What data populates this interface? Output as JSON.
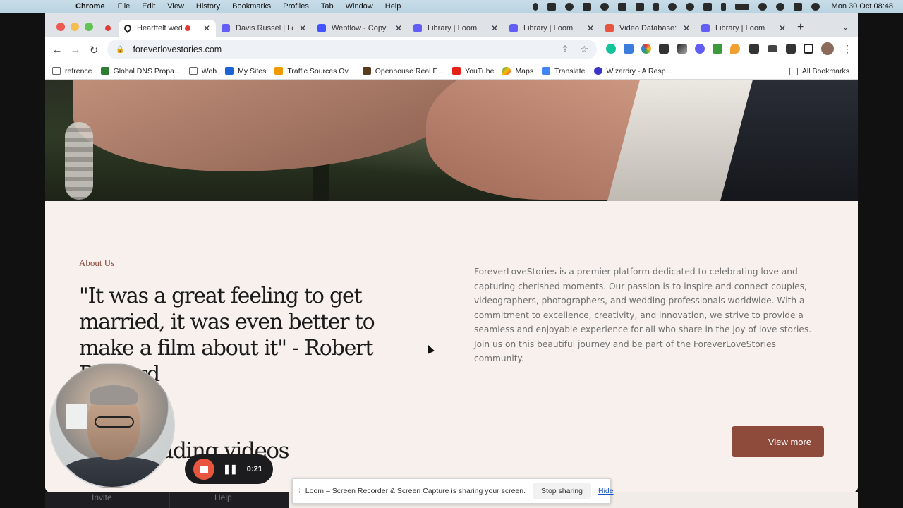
{
  "menubar": {
    "app": "Chrome",
    "items": [
      "File",
      "Edit",
      "View",
      "History",
      "Bookmarks",
      "Profiles",
      "Tab",
      "Window",
      "Help"
    ],
    "clock": "Mon 30 Oct  08:48"
  },
  "tabs": [
    {
      "title": "Heartfelt wed",
      "fav_color": "#222222",
      "active": true
    },
    {
      "title": "Davis Russel | Loo",
      "fav_color": "#625df5",
      "active": false
    },
    {
      "title": "Webflow - Copy o",
      "fav_color": "#4353ff",
      "active": false
    },
    {
      "title": "Library | Loom",
      "fav_color": "#625df5",
      "active": false
    },
    {
      "title": "Library | Loom",
      "fav_color": "#625df5",
      "active": false
    },
    {
      "title": "Video Database: V",
      "fav_color": "#e8553f",
      "active": false
    },
    {
      "title": "Library | Loom",
      "fav_color": "#625df5",
      "active": false
    }
  ],
  "address": {
    "url": "foreverlovestories.com"
  },
  "bookmarks": [
    {
      "label": "refrence",
      "icon": "folder-icon"
    },
    {
      "label": "Global DNS Propa...",
      "icon": "globe-icon"
    },
    {
      "label": "Web",
      "icon": "folder-icon"
    },
    {
      "label": "My Sites",
      "icon": "wordpress-icon"
    },
    {
      "label": "Traffic Sources Ov...",
      "icon": "analytics-icon"
    },
    {
      "label": "Openhouse Real E...",
      "icon": "house-icon"
    },
    {
      "label": "YouTube",
      "icon": "youtube-icon"
    },
    {
      "label": "Maps",
      "icon": "maps-icon"
    },
    {
      "label": "Translate",
      "icon": "translate-icon"
    },
    {
      "label": "Wizardry - A Resp...",
      "icon": "star-icon"
    }
  ],
  "all_bookmarks": "All Bookmarks",
  "page": {
    "about_label": "About Us",
    "quote": "\"It was a great feeling to get married, it was even better to make a film about it\" - Robert Redford",
    "about_body": "ForeverLoveStories is a premier platform dedicated to celebrating love and capturing cherished moments. Our passion is to inspire and connect couples, videographers, photographers, and wedding professionals worldwide. With a commitment to excellence, creativity, and innovation, we strive to provide a seamless and enjoyable experience for all who share in the joy of love stories. Join us on this beautiful journey and be part of the ForeverLoveStories community.",
    "view_more": "View more",
    "next_heading": "ding wedding videos"
  },
  "behind": {
    "invite": "Invite",
    "help": "Help"
  },
  "loom": {
    "timer": "0:21",
    "share_message": "Loom – Screen Recorder & Screen Capture is sharing your screen.",
    "stop_sharing": "Stop sharing",
    "hide": "Hide"
  }
}
